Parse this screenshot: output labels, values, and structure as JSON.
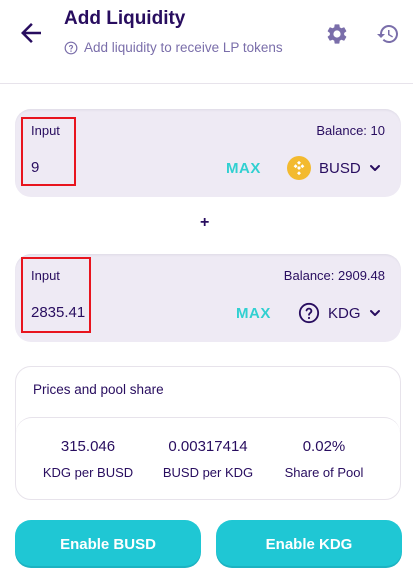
{
  "header": {
    "title": "Add Liquidity",
    "subtitle": "Add liquidity to receive LP tokens"
  },
  "input_a": {
    "label": "Input",
    "balance": "Balance: 10",
    "value": "9",
    "max_label": "MAX",
    "token": "BUSD"
  },
  "plus": "+",
  "input_b": {
    "label": "Input",
    "balance": "Balance: 2909.48",
    "value": "2835.41",
    "max_label": "MAX",
    "token": "KDG"
  },
  "pool": {
    "title": "Prices and pool share",
    "stats": [
      {
        "value": "315.046",
        "label": "KDG per BUSD"
      },
      {
        "value": "0.00317414",
        "label": "BUSD per KDG"
      },
      {
        "value": "0.02%",
        "label": "Share of Pool"
      }
    ]
  },
  "buttons": {
    "enable_a": "Enable BUSD",
    "enable_b": "Enable KDG"
  },
  "colors": {
    "primary_text": "#280d5f",
    "secondary_text": "#7a6eaa",
    "accent": "#1fc7d4",
    "max": "#31d0d1",
    "panel_bg": "#eeeaf4",
    "highlight": "#e8141e",
    "busd_coin": "#f3ba2f"
  },
  "icons": [
    "arrow-left-icon",
    "question-circle-icon",
    "gear-icon",
    "history-icon",
    "busd-token-icon",
    "chevron-down-icon",
    "unknown-token-icon"
  ]
}
